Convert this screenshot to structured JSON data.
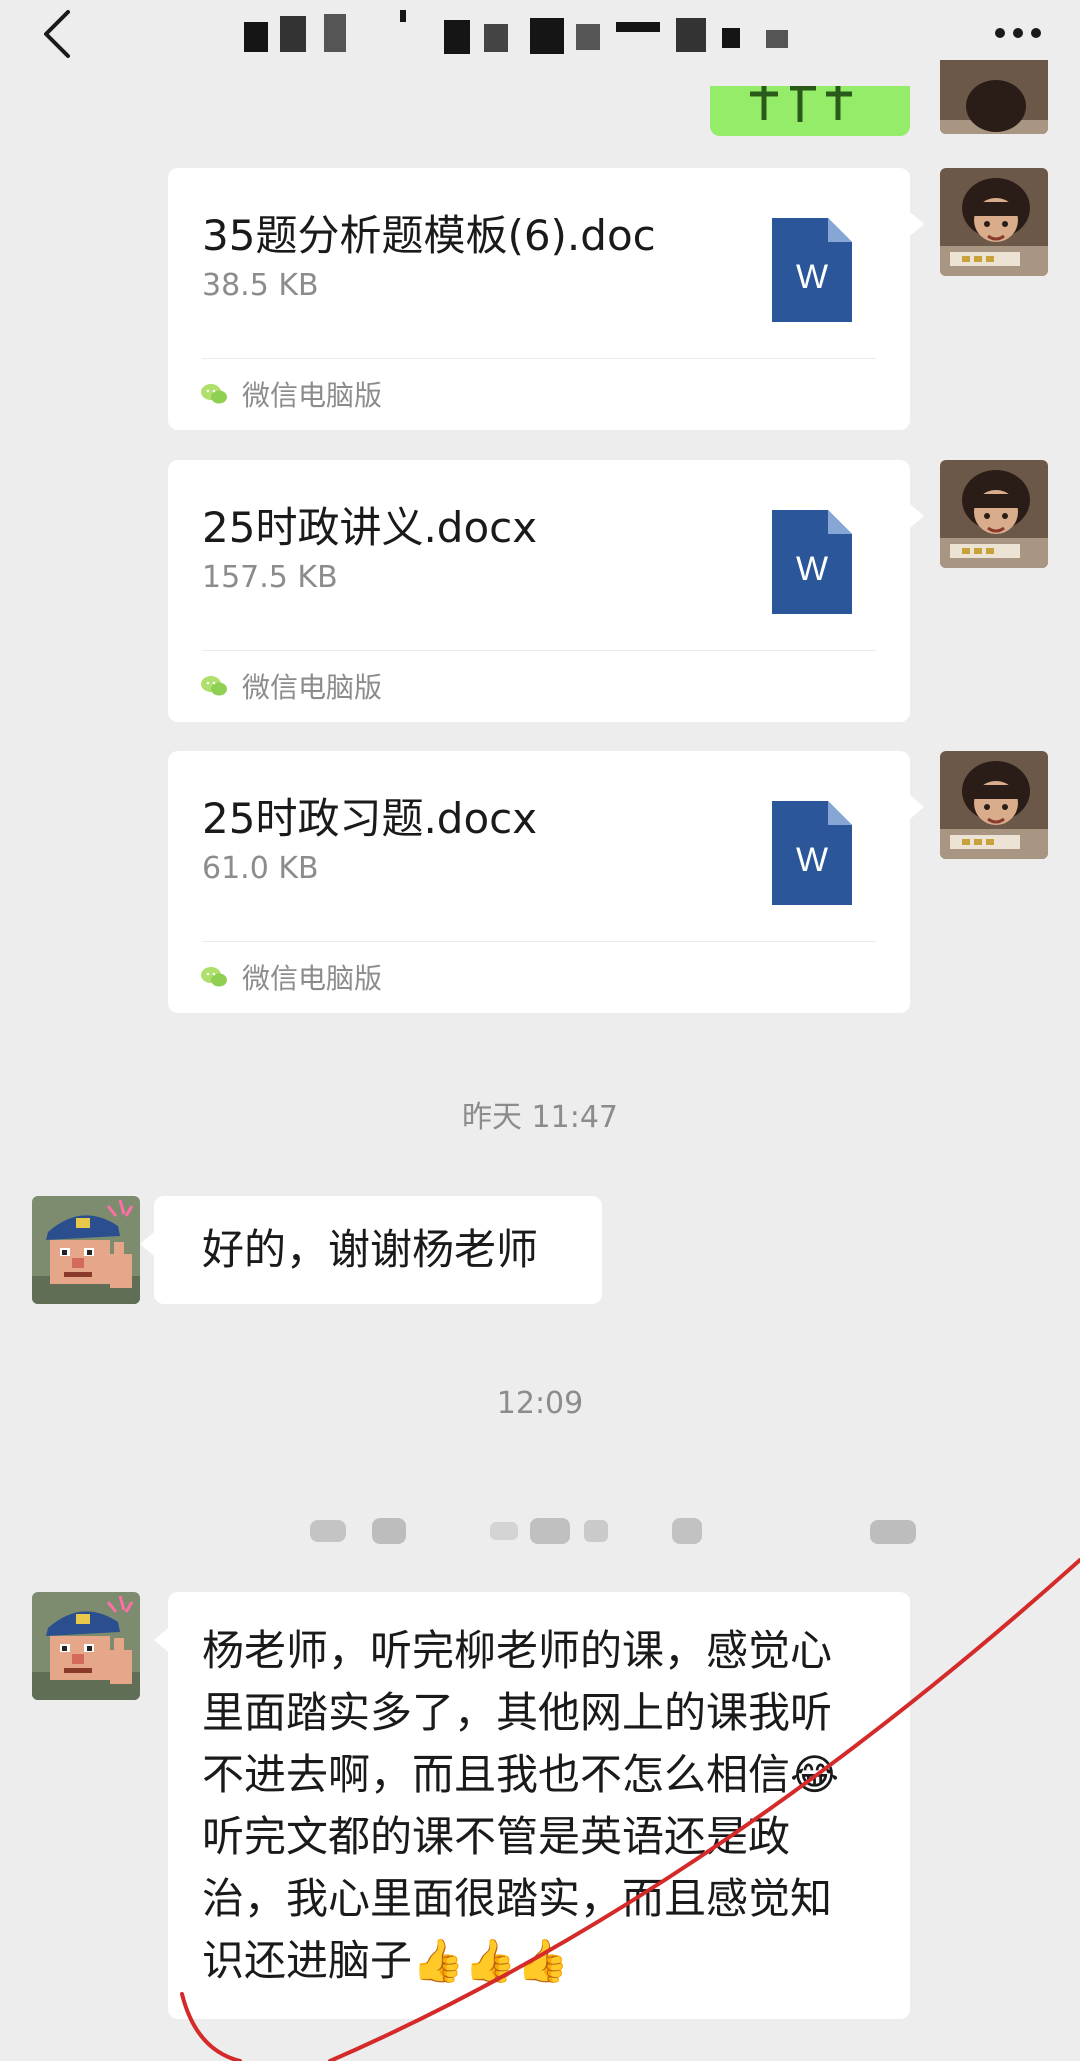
{
  "header": {
    "back_icon": "back-chevron-icon",
    "more_icon": "more-dots-icon",
    "title": ""
  },
  "files": [
    {
      "name": "35题分析题模板(6).doc",
      "size": "38.5 KB",
      "source": "微信电脑版",
      "icon": "word-file-icon"
    },
    {
      "name": "25时政讲义.docx",
      "size": "157.5 KB",
      "source": "微信电脑版",
      "icon": "word-file-icon"
    },
    {
      "name": "25时政习题.docx",
      "size": "61.0 KB",
      "source": "微信电脑版",
      "icon": "word-file-icon"
    }
  ],
  "timestamps": [
    "昨天 11:47",
    "12:09"
  ],
  "messages": [
    {
      "text": "好的，谢谢杨老师"
    },
    {
      "lines": [
        "杨老师，听完柳老师的课，感觉心",
        "里面踏实多了，其他网上的课我听",
        "不进去啊，而且我也不怎么相信😂",
        "听完文都的课不管是英语还是政",
        "治，我心里面很踏实，而且感觉知",
        "识还进脑子👍👍👍"
      ]
    }
  ],
  "colors": {
    "background": "#ededed",
    "bubble": "#ffffff",
    "sent_bubble": "#95ec69",
    "word_blue": "#2b579a",
    "annotation_red": "#d42a2a"
  }
}
